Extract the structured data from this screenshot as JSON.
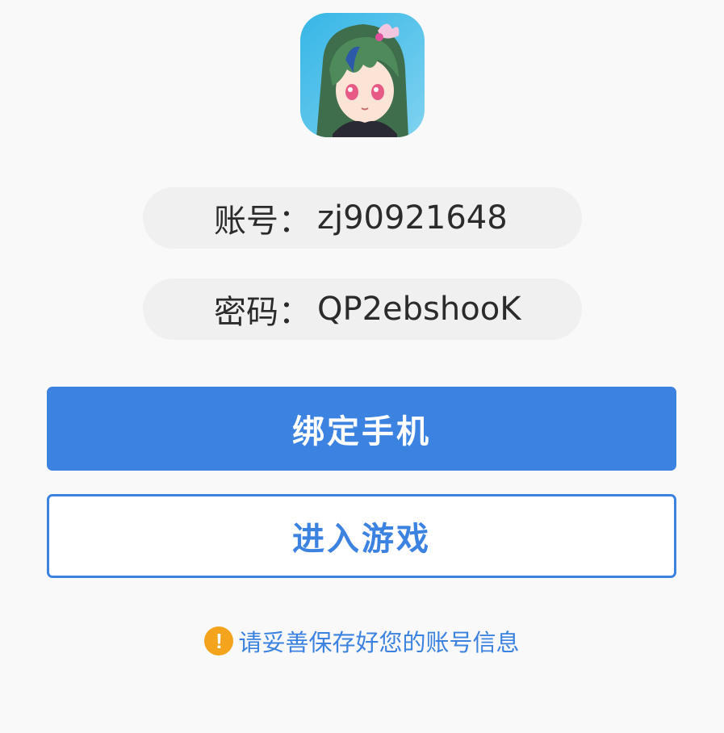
{
  "app": {
    "icon": "game-character-icon"
  },
  "credentials": {
    "account_label": "账号：",
    "account_value": "zj90921648",
    "password_label": "密码：",
    "password_value": "QP2ebshooK"
  },
  "buttons": {
    "bind_phone": "绑定手机",
    "enter_game": "进入游戏"
  },
  "notice": {
    "icon": "!",
    "text": "请妥善保存好您的账号信息"
  },
  "colors": {
    "accent": "#3c82e0",
    "warning": "#f4a41c",
    "field_bg": "#f0f0f0",
    "page_bg": "#f9f9f9"
  }
}
